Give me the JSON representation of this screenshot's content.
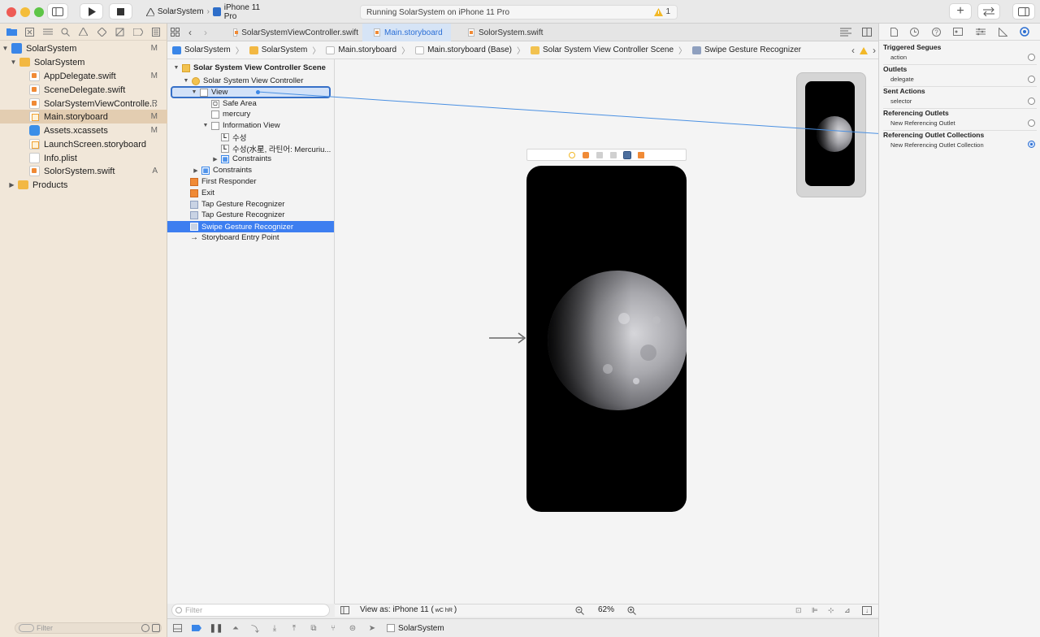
{
  "window": {
    "scheme_project": "SolarSystem",
    "scheme_device": "iPhone 11 Pro",
    "activity_status": "Running SolarSystem on iPhone 11 Pro",
    "warning_count": "1"
  },
  "navigator": {
    "items": [
      {
        "label": "SolarSystem",
        "badge": "M",
        "type": "project",
        "depth": 0
      },
      {
        "label": "SolarSystem",
        "badge": "",
        "type": "folder",
        "depth": 1
      },
      {
        "label": "AppDelegate.swift",
        "badge": "M",
        "type": "swift",
        "depth": 2
      },
      {
        "label": "SceneDelegate.swift",
        "badge": "",
        "type": "swift",
        "depth": 2
      },
      {
        "label": "SolarSystemViewControlle...",
        "badge": "R",
        "type": "swift",
        "depth": 2
      },
      {
        "label": "Main.storyboard",
        "badge": "M",
        "type": "storyboard",
        "depth": 2
      },
      {
        "label": "Assets.xcassets",
        "badge": "M",
        "type": "assets",
        "depth": 2
      },
      {
        "label": "LaunchScreen.storyboard",
        "badge": "",
        "type": "storyboard",
        "depth": 2
      },
      {
        "label": "Info.plist",
        "badge": "",
        "type": "plist",
        "depth": 2
      },
      {
        "label": "SolorSystem.swift",
        "badge": "A",
        "type": "swift",
        "depth": 2
      },
      {
        "label": "Products",
        "badge": "",
        "type": "folder",
        "depth": 0
      }
    ],
    "filter_placeholder": "Filter"
  },
  "tabs": [
    {
      "label": "SolarSystemViewController.swift",
      "active": false
    },
    {
      "label": "Main.storyboard",
      "active": true
    },
    {
      "label": "SolorSystem.swift",
      "active": false
    }
  ],
  "jumpbar": [
    "SolarSystem",
    "SolarSystem",
    "Main.storyboard",
    "Main.storyboard (Base)",
    "Solar System View Controller Scene",
    "Swipe Gesture Recognizer"
  ],
  "outline": {
    "items": [
      {
        "label": "Solar System View Controller Scene",
        "bold": true
      },
      {
        "label": "Solar System View Controller"
      },
      {
        "label": "View"
      },
      {
        "label": "Safe Area"
      },
      {
        "label": "mercury"
      },
      {
        "label": "Information View"
      },
      {
        "label": "수성"
      },
      {
        "label": "수성(水星, 라틴어: Mercuriu..."
      },
      {
        "label": "Constraints"
      },
      {
        "label": "Constraints"
      },
      {
        "label": "First Responder"
      },
      {
        "label": "Exit"
      },
      {
        "label": "Tap Gesture Recognizer"
      },
      {
        "label": "Tap Gesture Recognizer"
      },
      {
        "label": "Swipe Gesture Recognizer"
      },
      {
        "label": "Storyboard Entry Point"
      }
    ],
    "filter_placeholder": "Filter"
  },
  "canvas": {
    "view_as": "View as: iPhone 11 (",
    "size_class_w": "wC",
    "size_class_h": "hR",
    "view_as_end": ")",
    "zoom": "62%"
  },
  "debug_bar": {
    "target": "SolarSystem"
  },
  "inspector": {
    "sections": [
      {
        "title": "Triggered Segues",
        "item": "action",
        "connected": false
      },
      {
        "title": "Outlets",
        "item": "delegate",
        "connected": false
      },
      {
        "title": "Sent Actions",
        "item": "selector",
        "connected": false
      },
      {
        "title": "Referencing Outlets",
        "item": "New Referencing Outlet",
        "connected": false
      },
      {
        "title": "Referencing Outlet Collections",
        "item": "New Referencing Outlet Collection",
        "connected": true
      }
    ]
  }
}
